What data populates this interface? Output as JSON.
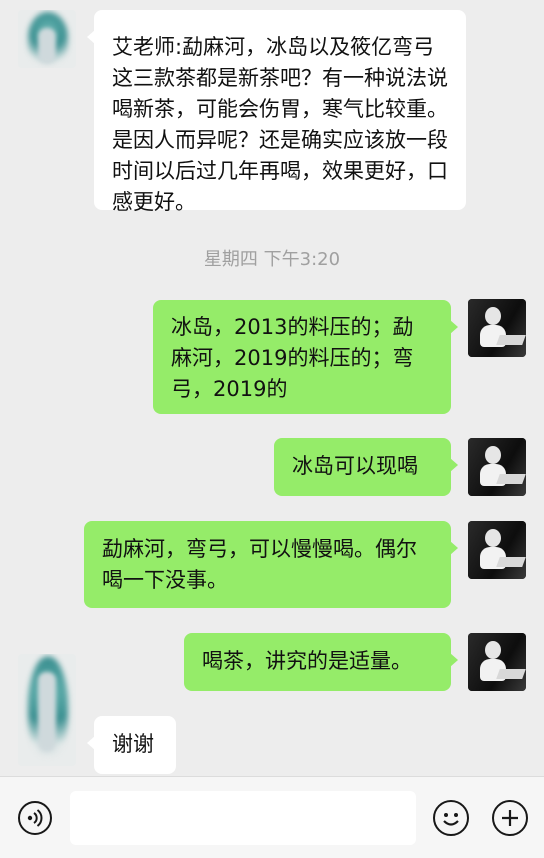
{
  "messages": [
    {
      "side": "in",
      "text": "艾老师:勐麻河，冰岛以及筱亿弯弓这三款茶都是新茶吧？有一种说法说喝新茶，可能会伤胃，寒气比较重。是因人而异呢？还是确实应该放一段时间以后过几年再喝，效果更好，口感更好。"
    },
    {
      "side": "out",
      "text": "冰岛，2013的料压的；勐麻河，2019的料压的；弯弓，2019的"
    },
    {
      "side": "out",
      "text": "冰岛可以现喝"
    },
    {
      "side": "out",
      "text": "勐麻河，弯弓，可以慢慢喝。偶尔喝一下没事。"
    },
    {
      "side": "out",
      "text": "喝茶，讲究的是适量。"
    },
    {
      "side": "in",
      "text": "谢谢"
    }
  ],
  "timestamp": "星期四 下午3:20",
  "input_bar": {
    "voice_icon": "voice-icon",
    "emoji_icon": "emoji-icon",
    "plus_icon": "plus-icon",
    "text_value": ""
  },
  "colors": {
    "background": "#ededed",
    "incoming_bubble": "#ffffff",
    "outgoing_bubble": "#95ec69",
    "timestamp": "#a0a0a0"
  }
}
